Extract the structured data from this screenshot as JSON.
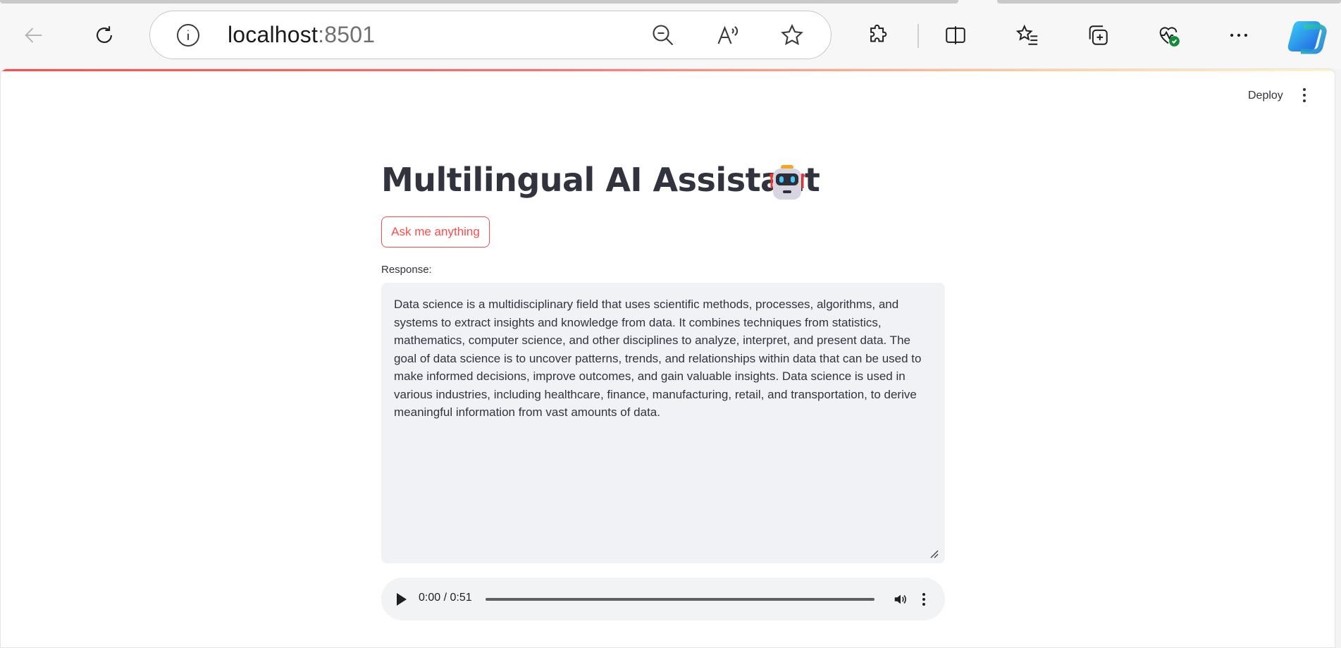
{
  "browser": {
    "url_host": "localhost",
    "url_port": ":8501",
    "icons": [
      "back-arrow-icon",
      "refresh-icon",
      "info-icon",
      "zoom-out-icon",
      "read-aloud-icon",
      "favorite-star-icon",
      "extensions-icon",
      "split-screen-icon",
      "favorites-icon",
      "collections-icon",
      "browser-essentials-icon",
      "more-menu-icon",
      "copilot-icon"
    ]
  },
  "app": {
    "deploy_label": "Deploy",
    "title": "Multilingual AI Assistant",
    "title_icon": "robot-icon",
    "ask_button_label": "Ask me anything",
    "response_label": "Response:",
    "response_text": "Data science is a multidisciplinary field that uses scientific methods, processes, algorithms, and systems to extract insights and knowledge from data. It combines techniques from statistics, mathematics, computer science, and other disciplines to analyze, interpret, and present data. The goal of data science is to uncover patterns, trends, and relationships within data that can be used to make informed decisions, improve outcomes, and gain valuable insights. Data science is used in various industries, including healthcare, finance, manufacturing, retail, and transportation, to derive meaningful information from vast amounts of data.",
    "audio": {
      "time_display": "0:00 / 0:51",
      "progress": 0
    }
  },
  "colors": {
    "accent": "#ff4b4b",
    "text": "#31333f",
    "response_bg": "#f0f2f6"
  }
}
